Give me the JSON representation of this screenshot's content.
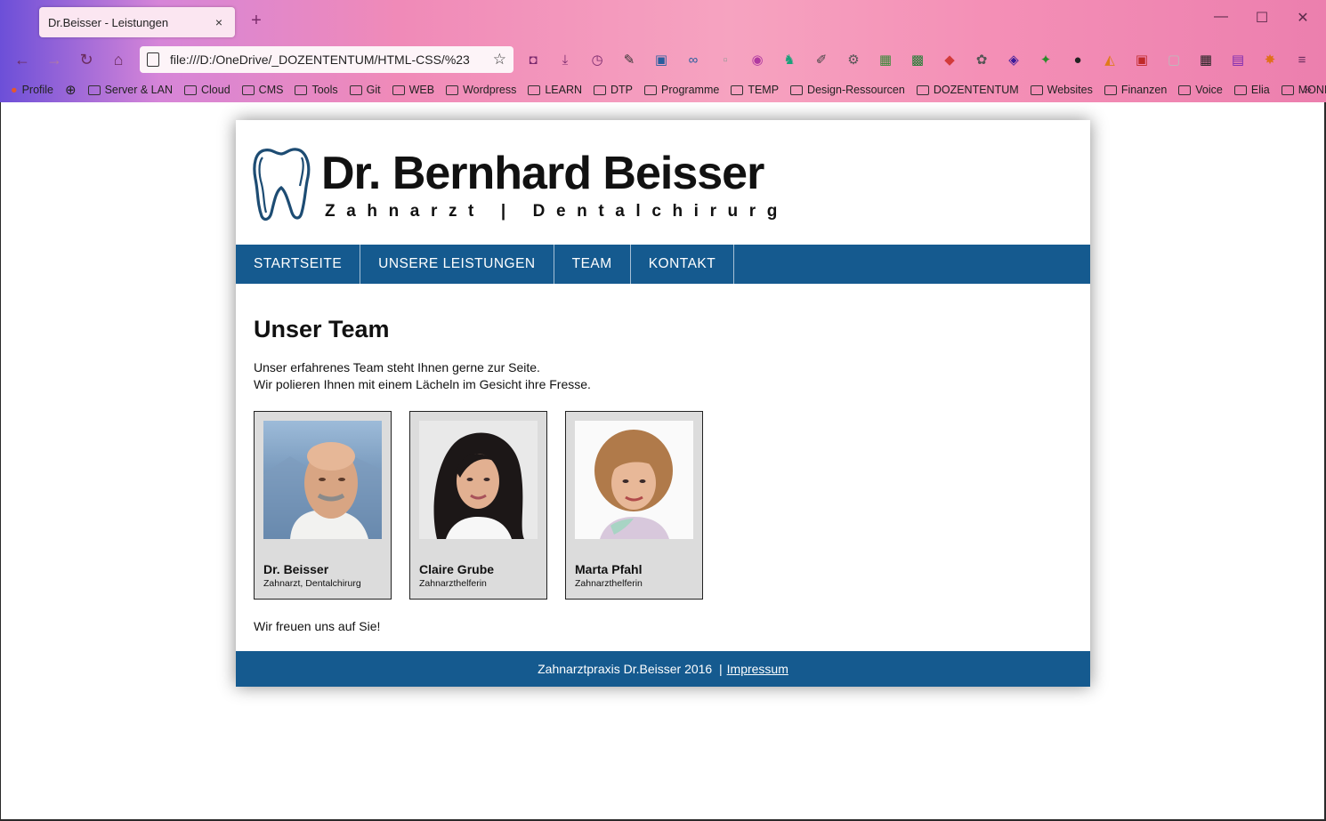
{
  "browser": {
    "tab_title": "Dr.Beisser - Leistungen",
    "tab_close": "×",
    "new_tab": "+",
    "url": "file:///D:/OneDrive/_DOZENTENTUM/HTML-CSS/%23",
    "window_controls": {
      "minimize": "—",
      "maximize": "☐",
      "close": "✕"
    },
    "bookmarks": [
      "Profile",
      "Server & LAN",
      "Cloud",
      "CMS",
      "Tools",
      "Git",
      "WEB",
      "Wordpress",
      "LEARN",
      "DTP",
      "Programme",
      "TEMP",
      "Design-Ressourcen",
      "DOZENTENTUM",
      "Websites",
      "Finanzen",
      "Voice",
      "Elia",
      "MONIUK"
    ]
  },
  "site": {
    "brand_name": "Dr. Bernhard Beisser",
    "brand_subtitle": "Zahnarzt | Dentalchirurg",
    "nav": [
      "STARTSEITE",
      "UNSERE LEISTUNGEN",
      "TEAM",
      "KONTAKT"
    ],
    "heading": "Unser Team",
    "intro_line1": "Unser erfahrenes Team steht Ihnen gerne zur Seite.",
    "intro_line2": "Wir polieren Ihnen mit einem Lächeln im Gesicht ihre Fresse.",
    "team": [
      {
        "name": "Dr. Beisser",
        "role": "Zahnarzt, Dentalchirurg"
      },
      {
        "name": "Claire Grube",
        "role": "Zahnarzthelferin"
      },
      {
        "name": "Marta Pfahl",
        "role": "Zahnarzthelferin"
      }
    ],
    "outro": "Wir freuen uns auf Sie!",
    "footer_text": "Zahnarztpraxis Dr.Beisser 2016  |",
    "footer_link": "Impressum"
  },
  "colors": {
    "nav_blue": "#155a8f",
    "card_bg": "#dcdcdc"
  }
}
